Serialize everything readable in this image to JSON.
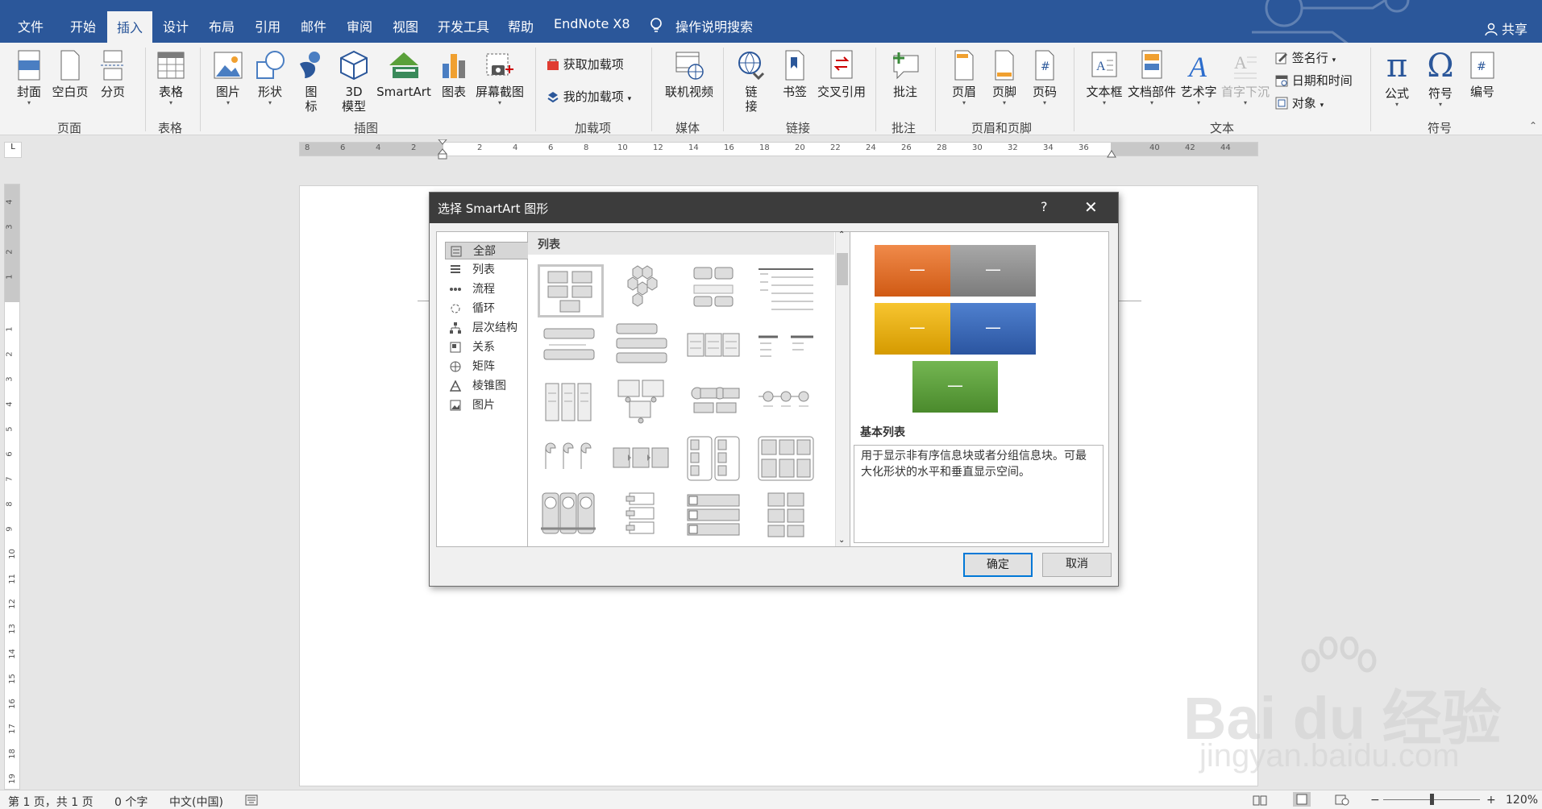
{
  "menu": {
    "tabs": [
      "文件",
      "开始",
      "插入",
      "设计",
      "布局",
      "引用",
      "邮件",
      "审阅",
      "视图",
      "开发工具",
      "帮助",
      "EndNote X8"
    ],
    "active_tab": "插入",
    "tell_me": "操作说明搜索",
    "share": "共享"
  },
  "ribbon": {
    "cover": "封面",
    "blank": "空白页",
    "pagebreak": "分页",
    "table": "表格",
    "picture": "图片",
    "shape": "形状",
    "icon_l1": "图",
    "icon_l2": "标",
    "model_l1": "3D",
    "model_l2": "模型",
    "smartart": "SmartArt",
    "chart": "图表",
    "screenshot": "屏幕截图",
    "get_addins": "获取加载项",
    "my_addins": "我的加载项",
    "online_video": "联机视频",
    "link_l1": "链",
    "link_l2": "接",
    "bookmark": "书签",
    "crossref": "交叉引用",
    "comment": "批注",
    "header": "页眉",
    "footer": "页脚",
    "pagenum": "页码",
    "textbox": "文本框",
    "quickparts": "文档部件",
    "wordart": "艺术字",
    "dropcap": "首字下沉",
    "signature": "签名行",
    "datetime": "日期和时间",
    "object": "对象",
    "equation": "公式",
    "symbol": "符号",
    "numbering": "编号",
    "groups": [
      "页面",
      "表格",
      "插图",
      "加载项",
      "媒体",
      "链接",
      "批注",
      "页眉和页脚",
      "文本",
      "符号"
    ]
  },
  "ruler": {
    "h_labels": [
      "8",
      "6",
      "4",
      "2",
      "2",
      "4",
      "6",
      "8",
      "10",
      "12",
      "14",
      "16",
      "18",
      "20",
      "22",
      "24",
      "26",
      "28",
      "30",
      "32",
      "34",
      "36",
      "40",
      "42",
      "44"
    ],
    "v_labels": [
      "4",
      "3",
      "2",
      "1",
      "1",
      "2",
      "3",
      "4",
      "5",
      "6",
      "7",
      "8",
      "9",
      "10",
      "11",
      "12",
      "13",
      "14",
      "15",
      "16",
      "17",
      "18",
      "19"
    ],
    "corner": "L"
  },
  "dialog": {
    "title": "选择 SmartArt 图形",
    "help": "?",
    "categories": [
      "全部",
      "列表",
      "流程",
      "循环",
      "层次结构",
      "关系",
      "矩阵",
      "棱锥图",
      "图片"
    ],
    "selected_category": "全部",
    "gallery_header": "列表",
    "preview_name": "基本列表",
    "preview_desc": "用于显示非有序信息块或者分组信息块。可最大化形状的水平和垂直显示空间。",
    "preview_colors": [
      "#e46c22",
      "#8e8e8e",
      "#f0b400",
      "#3565b8",
      "#5aa03a"
    ],
    "ok": "确定",
    "cancel": "取消"
  },
  "status": {
    "page": "第 1 页，共 1 页",
    "words": "0 个字",
    "lang": "中文(中国)",
    "zoom": "120%",
    "zoom_minus": "−",
    "zoom_plus": "+"
  },
  "watermark": {
    "logo": "Bai du 经验",
    "url": "jingyan.baidu.com"
  }
}
